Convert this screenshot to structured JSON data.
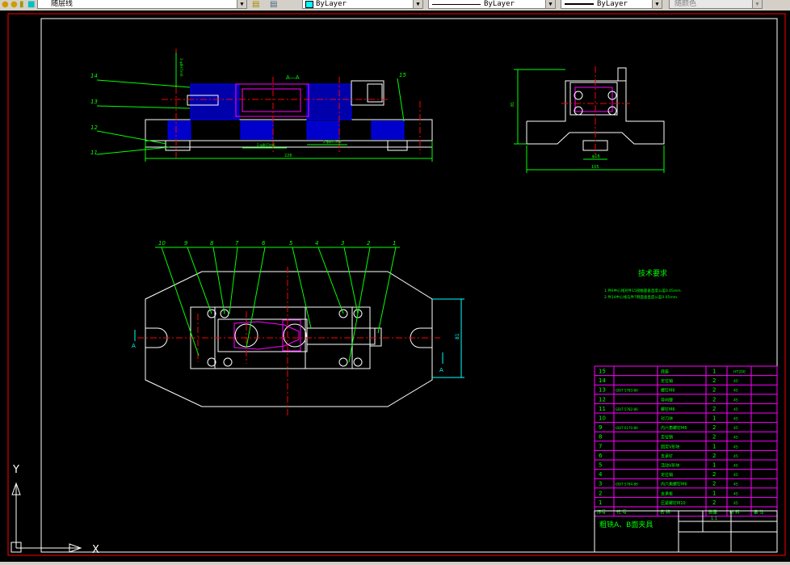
{
  "toolbar": {
    "layer_name": "随层线",
    "color_value": "ByLayer",
    "linetype_value": "ByLayer",
    "lineweight_value": "ByLayer",
    "plotstyle_value": "随颜色"
  },
  "colors": {
    "background": "#000000",
    "dimension": "#00ff00",
    "outline": "#ffffff",
    "center": "#ff0000",
    "hatch": "#0000ff",
    "highlight": "#ff00ff",
    "frame": "#ff0000"
  },
  "section_view": {
    "label": "A—A",
    "dim_total": "226",
    "fit_left": "2-φ8H7/m6",
    "fit_right": "2-φ8H7/m6",
    "fit_vertical": "2-φ8H7/m6",
    "callouts": [
      "14",
      "13",
      "12",
      "11",
      "15"
    ]
  },
  "side_view": {
    "dim_height": "81",
    "dim_width": "105",
    "dim_slot": "φ16"
  },
  "plan_view": {
    "callouts": [
      "10",
      "9",
      "8",
      "7",
      "6",
      "5",
      "4",
      "3",
      "2",
      "1"
    ],
    "section_marks": [
      "A",
      "A"
    ],
    "dim_height": "81"
  },
  "tech_req": {
    "title": "技术要求",
    "lines": [
      "1.件6中心线对件15接触面垂直度公差0.05mm.",
      "2.件14中心线与件7侧面垂直度公差0.05mm."
    ]
  },
  "bom": {
    "headers": [
      "序号",
      "代 号",
      "名 称",
      "数量",
      "材 料",
      "备 注"
    ],
    "rows": [
      {
        "no": "15",
        "code": "",
        "name": "底座",
        "qty": "1",
        "mat": "HT200"
      },
      {
        "no": "14",
        "code": "",
        "name": "定位销",
        "qty": "2",
        "mat": "45"
      },
      {
        "no": "13",
        "code": "GB/T 5783-86",
        "name": "螺钉M6",
        "qty": "2",
        "mat": "45"
      },
      {
        "no": "12",
        "code": "",
        "name": "导向键",
        "qty": "2",
        "mat": "45"
      },
      {
        "no": "11",
        "code": "GB/T 5782-86",
        "name": "螺钉M6",
        "qty": "2",
        "mat": "45"
      },
      {
        "no": "10",
        "code": "",
        "name": "对刀块",
        "qty": "1",
        "mat": "45"
      },
      {
        "no": "9",
        "code": "GB/T 6170-86",
        "name": "内六角螺钉M6",
        "qty": "2",
        "mat": "45"
      },
      {
        "no": "8",
        "code": "",
        "name": "定位销",
        "qty": "2",
        "mat": "45"
      },
      {
        "no": "7",
        "code": "",
        "name": "固定V形块",
        "qty": "1",
        "mat": "45"
      },
      {
        "no": "6",
        "code": "",
        "name": "支承钉",
        "qty": "2",
        "mat": "45"
      },
      {
        "no": "5",
        "code": "",
        "name": "活动V形块",
        "qty": "1",
        "mat": "45"
      },
      {
        "no": "4",
        "code": "",
        "name": "定位销",
        "qty": "2",
        "mat": "45"
      },
      {
        "no": "3",
        "code": "GB/T 5784-86",
        "name": "内六角螺钉M6",
        "qty": "2",
        "mat": "45"
      },
      {
        "no": "2",
        "code": "",
        "name": "支承板",
        "qty": "1",
        "mat": "45"
      },
      {
        "no": "1",
        "code": "",
        "name": "压紧螺钉M10",
        "qty": "2",
        "mat": "45"
      }
    ],
    "title_block_name": "粗铣A、B面夹具",
    "title_block_scale": "1:1"
  },
  "ucs": {
    "x_label": "X",
    "y_label": "Y"
  }
}
